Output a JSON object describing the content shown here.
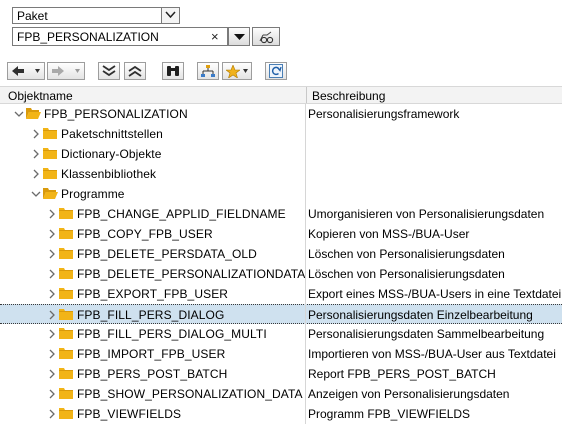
{
  "selector": {
    "object_type": "Paket",
    "object_name": "FPB_PERSONALIZATION",
    "clear_symbol": "×"
  },
  "toolbar": {
    "buttons": [
      {
        "name": "back-button",
        "icon": "arrow-left-icon"
      },
      {
        "name": "forward-button",
        "icon": "arrow-right-icon"
      },
      {
        "name": "collapse-all-button",
        "icon": "double-chevron-down-icon"
      },
      {
        "name": "expand-all-button",
        "icon": "double-chevron-up-icon"
      },
      {
        "name": "find-button",
        "icon": "binoculars-icon"
      },
      {
        "name": "hierarchy-button",
        "icon": "hierarchy-icon"
      },
      {
        "name": "favorites-button",
        "icon": "star-icon"
      },
      {
        "name": "refresh-button",
        "icon": "refresh-icon"
      }
    ]
  },
  "columns": {
    "name": "Objektname",
    "description": "Beschreibung"
  },
  "tree": {
    "rows": [
      {
        "name": "FPB_PERSONALIZATION",
        "desc": "Personalisierungsframework",
        "expanded": true,
        "selected": false
      },
      {
        "name": "Paketschnittstellen",
        "desc": "",
        "expanded": false,
        "selected": false
      },
      {
        "name": "Dictionary-Objekte",
        "desc": "",
        "expanded": false,
        "selected": false
      },
      {
        "name": "Klassenbibliothek",
        "desc": "",
        "expanded": false,
        "selected": false
      },
      {
        "name": "Programme",
        "desc": "",
        "expanded": true,
        "selected": false
      },
      {
        "name": "FPB_CHANGE_APPLID_FIELDNAME",
        "desc": "Umorganisieren von Personalisierungsdaten",
        "expanded": false,
        "selected": false
      },
      {
        "name": "FPB_COPY_FPB_USER",
        "desc": "Kopieren von MSS-/BUA-User",
        "expanded": false,
        "selected": false
      },
      {
        "name": "FPB_DELETE_PERSDATA_OLD",
        "desc": "Löschen von Personalisierungsdaten",
        "expanded": false,
        "selected": false
      },
      {
        "name": "FPB_DELETE_PERSONALIZATIONDATA",
        "desc": "Löschen von Personalisierungsdaten",
        "expanded": false,
        "selected": false
      },
      {
        "name": "FPB_EXPORT_FPB_USER",
        "desc": "Export eines MSS-/BUA-Users in eine Textdatei",
        "expanded": false,
        "selected": false
      },
      {
        "name": "FPB_FILL_PERS_DIALOG",
        "desc": "Personalisierungsdaten Einzelbearbeitung",
        "expanded": false,
        "selected": true
      },
      {
        "name": "FPB_FILL_PERS_DIALOG_MULTI",
        "desc": "Personalisierungsdaten Sammelbearbeitung",
        "expanded": false,
        "selected": false
      },
      {
        "name": "FPB_IMPORT_FPB_USER",
        "desc": "Importieren von MSS-/BUA-User aus Textdatei",
        "expanded": false,
        "selected": false
      },
      {
        "name": "FPB_PERS_POST_BATCH",
        "desc": "Report FPB_PERS_POST_BATCH",
        "expanded": false,
        "selected": false
      },
      {
        "name": "FPB_SHOW_PERSONALIZATION_DATA",
        "desc": "Anzeigen von Personalisierungsdaten",
        "expanded": false,
        "selected": false
      },
      {
        "name": "FPB_VIEWFIELDS",
        "desc": "Programm FPB_VIEWFIELDS",
        "expanded": false,
        "selected": false
      }
    ]
  },
  "colors": {
    "folder": "#f2b417",
    "selection": "#cfe1ef",
    "chevron": "#6b6b6b"
  }
}
